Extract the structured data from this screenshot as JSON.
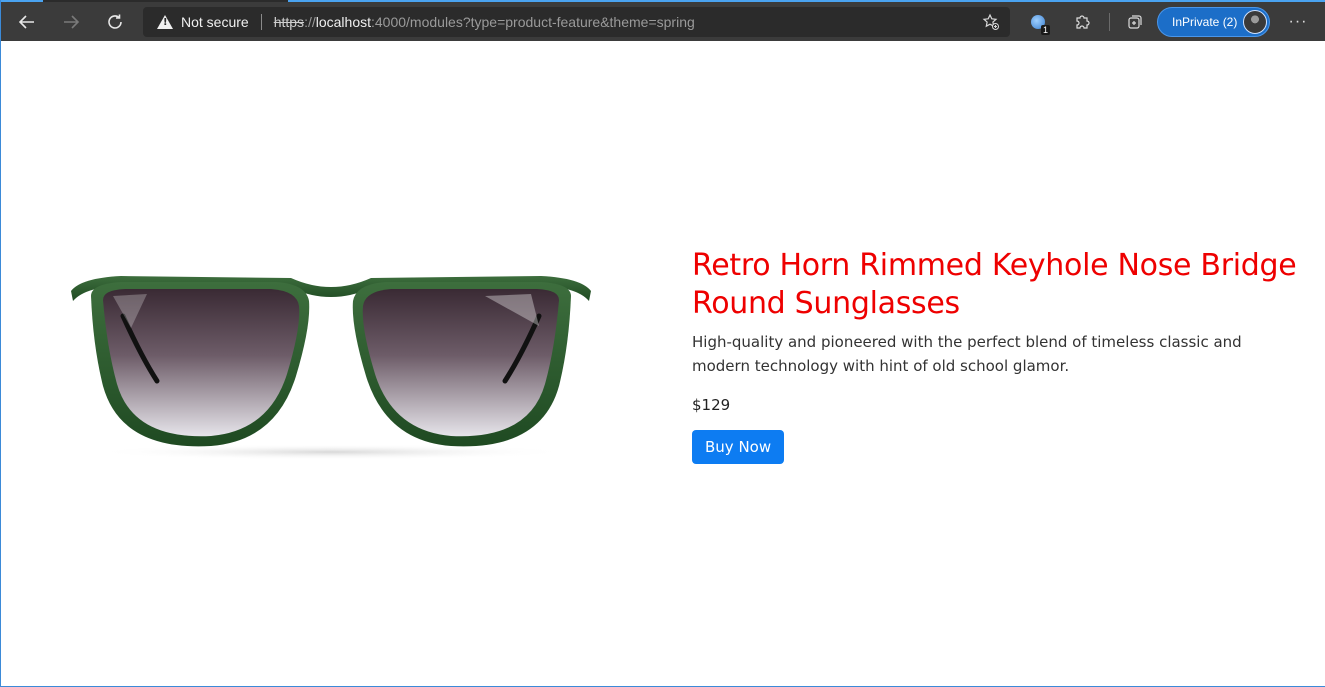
{
  "browser": {
    "security_warning": "Not secure",
    "url": {
      "scheme": "https",
      "separator": "://",
      "host": "localhost",
      "rest": ":4000/modules?type=product-feature&theme=spring"
    },
    "extension_badge": "1",
    "profile_label": "InPrivate (2)",
    "more_label": "···",
    "icons": {
      "back": "arrow-left-icon",
      "forward": "arrow-right-icon",
      "refresh": "refresh-icon",
      "warning": "warning-triangle-icon",
      "favorite": "star-plus-icon",
      "extensions": "puzzle-icon",
      "collections": "collections-icon",
      "more": "ellipsis-icon"
    }
  },
  "product": {
    "title": "Retro Horn Rimmed Keyhole Nose Bridge Round Sunglasses",
    "description": "High-quality and pioneered with the perfect blend of timeless classic and modern technology with hint of old school glamor.",
    "price": "$129",
    "cta_label": "Buy Now",
    "title_color": "#ee0000",
    "cta_color": "#0d7cf2"
  }
}
